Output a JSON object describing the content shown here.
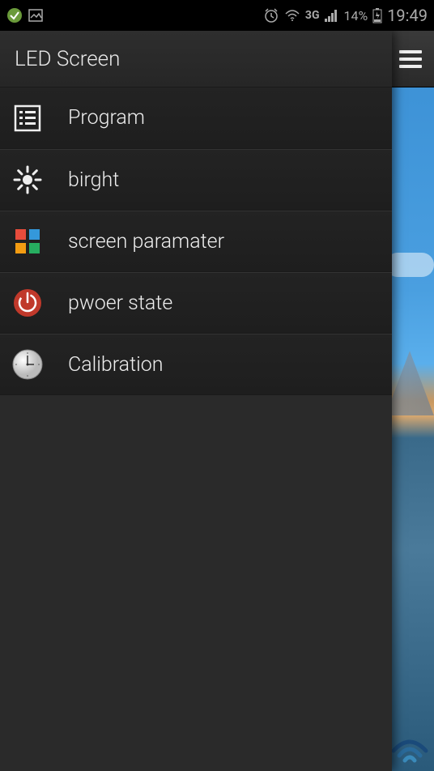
{
  "status_bar": {
    "network_type": "3G",
    "battery_pct": "14%",
    "clock": "19:49"
  },
  "app": {
    "title": "LED Screen"
  },
  "menu": {
    "items": [
      {
        "label": "Program"
      },
      {
        "label": "birght"
      },
      {
        "label": "screen paramater"
      },
      {
        "label": "pwoer state"
      },
      {
        "label": "Calibration"
      }
    ]
  }
}
